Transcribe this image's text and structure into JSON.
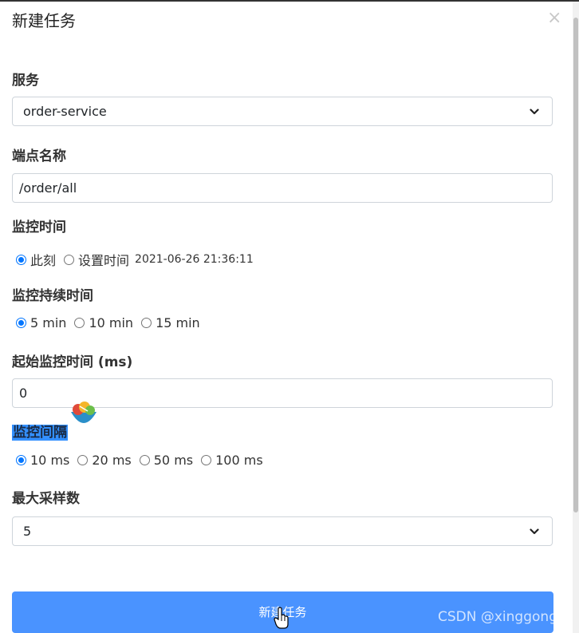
{
  "modal": {
    "title": "新建任务",
    "close_icon": "close-icon"
  },
  "form": {
    "service": {
      "label": "服务",
      "value": "order-service"
    },
    "endpoint": {
      "label": "端点名称",
      "value": "/order/all"
    },
    "monitor_time": {
      "label": "监控时间",
      "options": [
        "此刻",
        "设置时间"
      ],
      "selected": "此刻",
      "timestamp": "2021-06-26 21:36:11"
    },
    "duration": {
      "label": "监控持续时间",
      "options": [
        "5 min",
        "10 min",
        "15 min"
      ],
      "selected": "5 min"
    },
    "start_offset": {
      "label": "起始监控时间 (ms)",
      "value": "0"
    },
    "interval": {
      "label": "监控间隔",
      "options": [
        "10 ms",
        "20 ms",
        "50 ms",
        "100 ms"
      ],
      "selected": "10 ms"
    },
    "max_samples": {
      "label": "最大采样数",
      "value": "5"
    }
  },
  "submit": {
    "label": "新建任务"
  },
  "watermark": "CSDN @xinggongzi",
  "colors": {
    "accent": "#0075ff",
    "button": "#4a93ff",
    "selection_highlight": "#3390ff"
  }
}
